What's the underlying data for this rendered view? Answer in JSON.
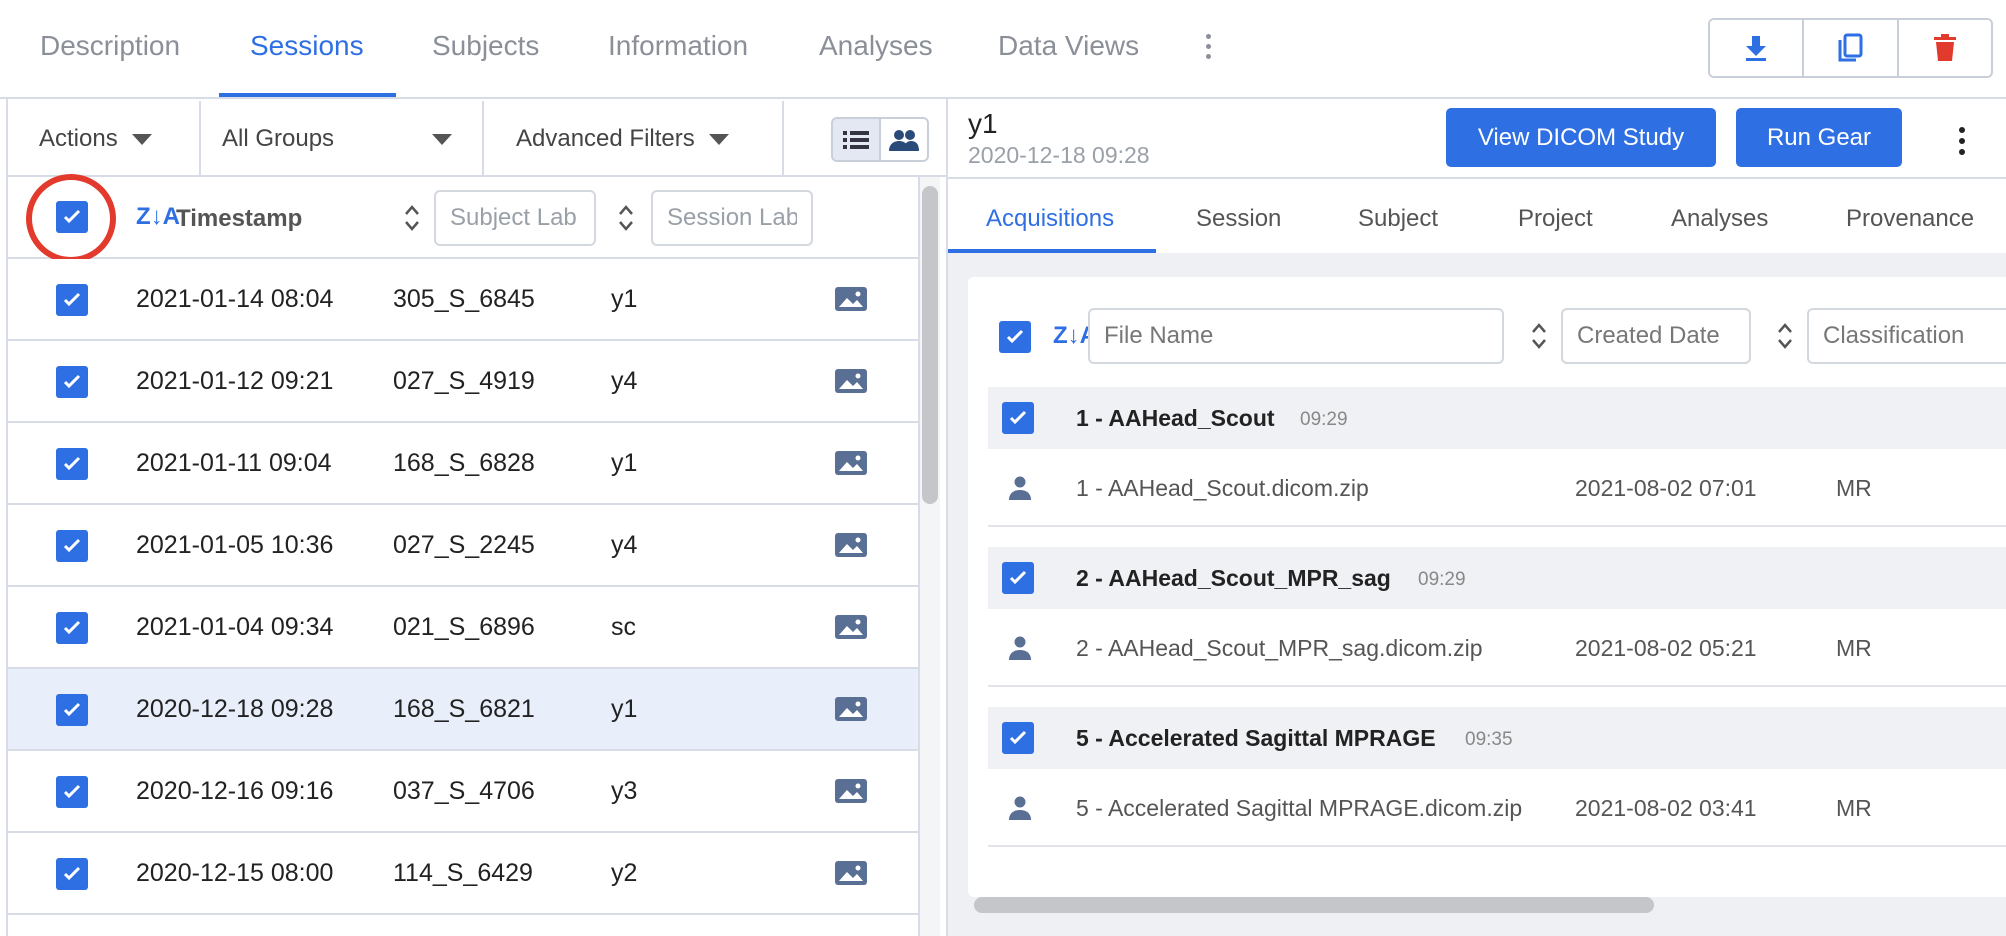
{
  "top_tabs": [
    "Description",
    "Sessions",
    "Subjects",
    "Information",
    "Analyses",
    "Data Views"
  ],
  "active_top_tab": "Sessions",
  "toolbar": {
    "actions_label": "Actions",
    "group_label": "All Groups",
    "filters_label": "Advanced Filters"
  },
  "table": {
    "timestamp_header": "Timestamp",
    "subject_placeholder": "Subject Lab",
    "session_placeholder": "Session Lab",
    "rows": [
      {
        "timestamp": "2021-01-14 08:04",
        "subject": "305_S_6845",
        "session": "y1"
      },
      {
        "timestamp": "2021-01-12 09:21",
        "subject": "027_S_4919",
        "session": "y4"
      },
      {
        "timestamp": "2021-01-11 09:04",
        "subject": "168_S_6828",
        "session": "y1"
      },
      {
        "timestamp": "2021-01-05 10:36",
        "subject": "027_S_2245",
        "session": "y4"
      },
      {
        "timestamp": "2021-01-04 09:34",
        "subject": "021_S_6896",
        "session": "sc"
      },
      {
        "timestamp": "2020-12-18 09:28",
        "subject": "168_S_6821",
        "session": "y1"
      },
      {
        "timestamp": "2020-12-16 09:16",
        "subject": "037_S_4706",
        "session": "y3"
      },
      {
        "timestamp": "2020-12-15 08:00",
        "subject": "114_S_6429",
        "session": "y2"
      }
    ],
    "selected_row": 5
  },
  "detail": {
    "title": "y1",
    "subtitle": "2020-12-18 09:28",
    "view_dicom_label": "View DICOM Study",
    "run_gear_label": "Run Gear",
    "tabs": [
      "Acquisitions",
      "Session",
      "Subject",
      "Project",
      "Analyses",
      "Provenance"
    ],
    "active_tab": "Acquisitions",
    "file_name_placeholder": "File Name",
    "created_date_placeholder": "Created Date",
    "classification_placeholder": "Classification",
    "acquisitions": [
      {
        "name": "1 - AAHead_Scout",
        "time": "09:29",
        "file": "1 - AAHead_Scout.dicom.zip",
        "created": "2021-08-02 07:01",
        "classification": "MR"
      },
      {
        "name": "2 - AAHead_Scout_MPR_sag",
        "time": "09:29",
        "file": "2 - AAHead_Scout_MPR_sag.dicom.zip",
        "created": "2021-08-02 05:21",
        "classification": "MR"
      },
      {
        "name": "5 - Accelerated Sagittal MPRAGE",
        "time": "09:35",
        "file": "5 - Accelerated Sagittal MPRAGE.dicom.zip",
        "created": "2021-08-02 03:41",
        "classification": "MR"
      }
    ]
  },
  "colors": {
    "accent": "#2f6fe4",
    "delete": "#e23a2c",
    "highlight_ring": "#e23a2c",
    "selected_row": "#e8effb"
  }
}
